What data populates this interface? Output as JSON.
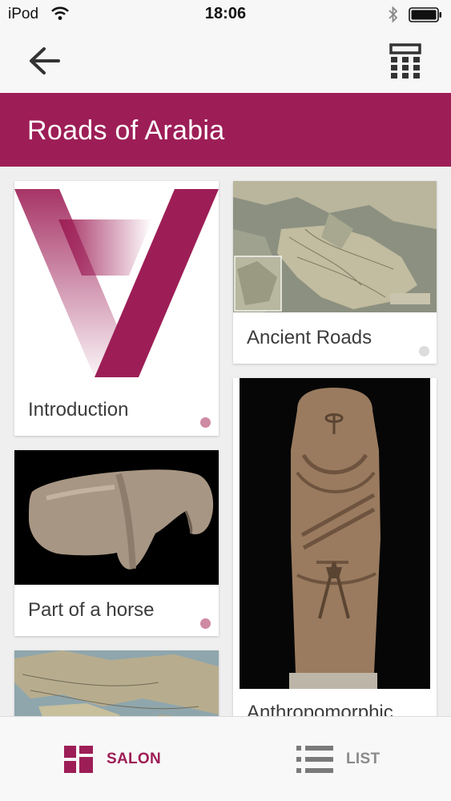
{
  "status_bar": {
    "carrier": "iPod",
    "time": "18:06"
  },
  "nav": {
    "back_icon": "back-arrow-icon",
    "right_icon": "calculator-grid-icon"
  },
  "banner": {
    "title": "Roads of Arabia",
    "color": "#9d1e56"
  },
  "cards": {
    "introduction": {
      "label": "Introduction",
      "image": "roads-of-arabia-logo",
      "indicator": "pink"
    },
    "ancient_roads": {
      "label": "Ancient Roads",
      "image": "map-of-arabia",
      "indicator": "grey"
    },
    "horse": {
      "label": "Part of a horse",
      "image": "stone-horse-fragment",
      "indicator": "pink"
    },
    "stele": {
      "label": "Anthropomorphic stele",
      "image": "anthropomorphic-stone-stele"
    },
    "map_partial": {
      "image": "region-map"
    }
  },
  "tabs": {
    "salon": {
      "label": "SALON",
      "icon": "salon-grid-icon",
      "active": true
    },
    "list": {
      "label": "LIST",
      "icon": "list-icon",
      "active": false
    }
  },
  "colors": {
    "accent": "#9d1e56",
    "indicator_pink": "#cf8aa3",
    "indicator_grey": "#dcdcdc"
  }
}
